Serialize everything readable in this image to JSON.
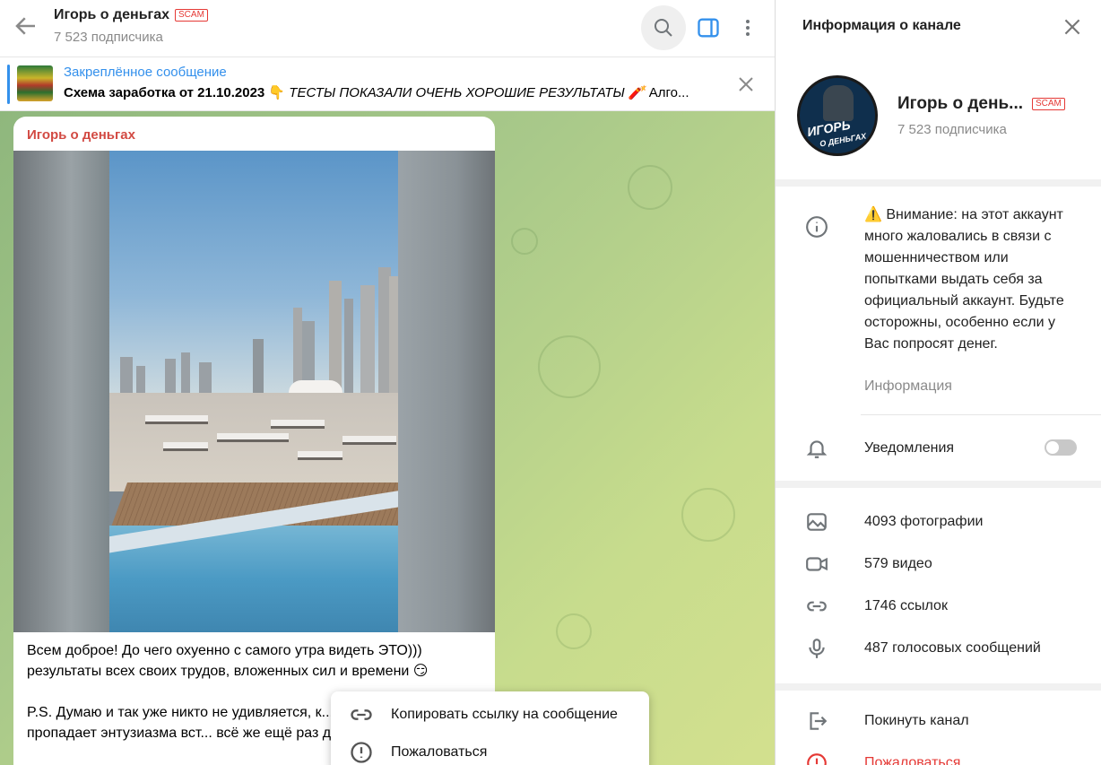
{
  "chat": {
    "title": "Игорь о деньгах",
    "scam_badge": "SCAM",
    "subscribers": "7 523 подписчика"
  },
  "pinned": {
    "label": "Закреплённое сообщение",
    "text_bold": "Схема заработка от 21.10.2023 👇",
    "text_italic": "ТЕСТЫ ПОКАЗАЛИ ОЧЕНЬ ХОРОШИЕ РЕЗУЛЬТАТЫ 🧨",
    "text_tail": "Алго..."
  },
  "message": {
    "author": "Игорь о деньгах",
    "paragraph1": "Всем доброе! До чего охуенно с самого утра видеть ЭТО))) результаты всех своих трудов, вложенных сил и времени 😏",
    "paragraph2": "P.S. Думаю и так уже никто не удивляется, к... недели у меня не пропадает энтузиазма вст... всё же ещё раз демонстрирую 😄👆"
  },
  "context_menu": {
    "copy_link": "Копировать ссылку на сообщение",
    "report": "Пожаловаться"
  },
  "panel": {
    "title": "Информация о канале",
    "channel_name": "Игорь о день...",
    "scam_badge": "SCAM",
    "subscribers": "7 523 подписчика",
    "avatar_text": "ИГОРЬ",
    "avatar_subtext": "О ДЕНЬГАХ",
    "warning": "⚠️ Внимание: на этот аккаунт много жаловались в связи с мошенничеством или попытками выдать себя за официальный аккаунт. Будьте осторожны, особенно если у Вас попросят денег.",
    "info_label": "Информация",
    "notifications_label": "Уведомления",
    "notifications_on": false,
    "photos": "4093 фотографии",
    "videos": "579 видео",
    "links": "1746 ссылок",
    "voice": "487 голосовых сообщений",
    "leave": "Покинуть канал",
    "report": "Пожаловаться"
  },
  "colors": {
    "accent": "#3390ec",
    "author": "#d24a43",
    "scam": "#e53935"
  }
}
